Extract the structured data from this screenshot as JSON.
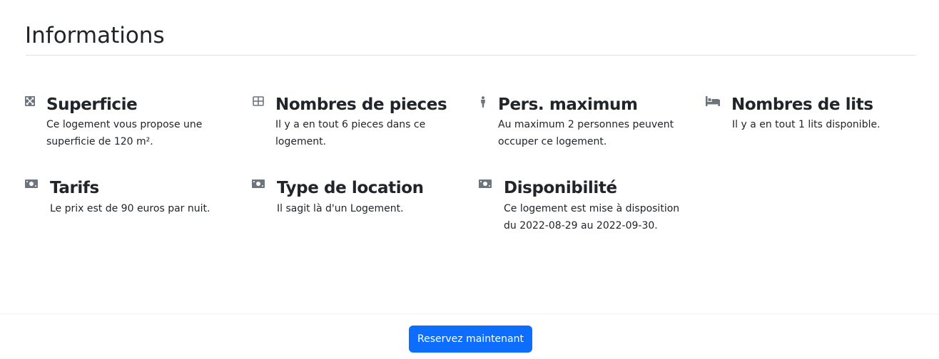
{
  "section": {
    "title": "Informations"
  },
  "features": {
    "surface": {
      "icon": "arrows-expand-icon",
      "title": "Superficie",
      "line1": "Ce logement vous propose une",
      "line2": "superficie de 120 m².",
      "value": "120 m²"
    },
    "rooms": {
      "icon": "grid-icon",
      "title": "Nombres de pieces",
      "line1": "Il y a en tout 6 pieces dans ce",
      "line2": "logement.",
      "value": "6"
    },
    "max_people": {
      "icon": "person-icon",
      "title": "Pers. maximum",
      "line1": "Au maximum 2 personnes peuvent",
      "line2": "occuper ce logement.",
      "value": "2"
    },
    "beds": {
      "icon": "bed-icon",
      "title": "Nombres de lits",
      "line1": "Il y a en tout 1 lits disponible.",
      "value": "1"
    },
    "price": {
      "icon": "money-icon",
      "title": "Tarifs",
      "line1": "Le prix est de 90 euros par nuit.",
      "value": "90 euros"
    },
    "rental_type": {
      "icon": "money-icon",
      "title": "Type de location",
      "line1": "Il sagit là d'un Logement.",
      "value": "Logement"
    },
    "availability": {
      "icon": "money-icon",
      "title": "Disponibilité",
      "line1": "Ce logement est mise à disposition",
      "line2": "du 2022-08-29 au 2022-09-30.",
      "from": "2022-08-29",
      "to": "2022-09-30"
    }
  },
  "footer": {
    "reserve_label": "Reservez maintenant"
  },
  "colors": {
    "primary": "#0d6efd",
    "icon": "#6c757d",
    "text": "#212529",
    "rule": "#dee2e6"
  }
}
